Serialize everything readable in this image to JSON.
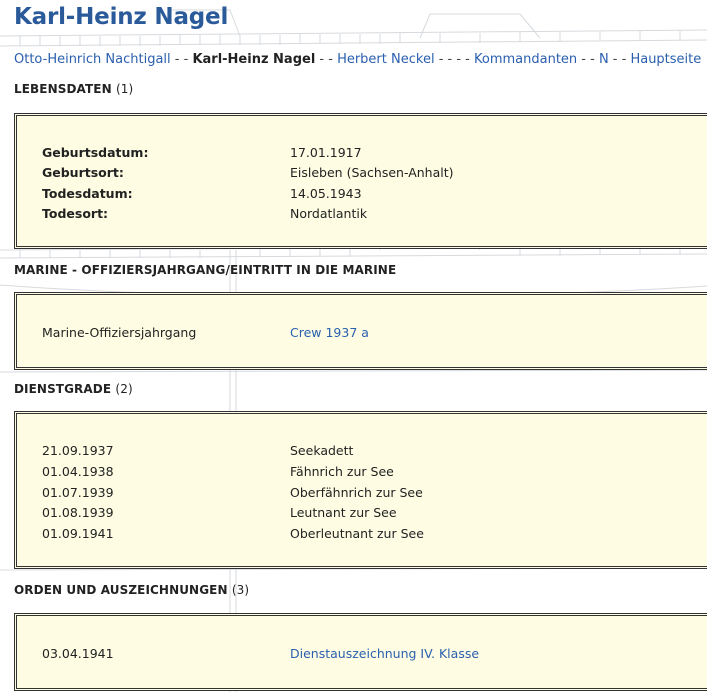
{
  "page": {
    "title": "Karl-Heinz Nagel"
  },
  "breadcrumb": {
    "prev": "Otto-Heinrich Nachtigall",
    "sep1": " - - ",
    "current": "Karl-Heinz Nagel",
    "sep2": " - - ",
    "next": "Herbert Neckel",
    "sep3": " - - - - ",
    "commanders": "Kommandanten",
    "sep4": " - - ",
    "letter": "N",
    "sep5": " - - ",
    "home": "Hauptseite"
  },
  "lebensdaten": {
    "heading": "LEBENSDATEN",
    "count": "(1)",
    "rows": [
      {
        "label": "Geburtsdatum:",
        "value": "17.01.1917"
      },
      {
        "label": "Geburtsort:",
        "value": "Eisleben (Sachsen-Anhalt)"
      },
      {
        "label": "Todesdatum:",
        "value": "14.05.1943"
      },
      {
        "label": "Todesort:",
        "value": "Nordatlantik"
      }
    ]
  },
  "marine": {
    "heading": "MARINE - OFFIZIERSJAHRGANG/EINTRITT IN DIE MARINE",
    "rows": [
      {
        "label": "Marine-Offiziersjahrgang",
        "value": "Crew 1937 a"
      }
    ]
  },
  "dienstgrade": {
    "heading": "DIENSTGRADE",
    "count": "(2)",
    "rows": [
      {
        "date": "21.09.1937",
        "rank": "Seekadett"
      },
      {
        "date": "01.04.1938",
        "rank": "Fähnrich zur See"
      },
      {
        "date": "01.07.1939",
        "rank": "Oberfähnrich zur See"
      },
      {
        "date": "01.08.1939",
        "rank": "Leutnant zur See"
      },
      {
        "date": "01.09.1941",
        "rank": "Oberleutnant zur See"
      }
    ]
  },
  "orden": {
    "heading": "ORDEN UND AUSZEICHNUNGEN",
    "count": "(3)",
    "rows": [
      {
        "date": "03.04.1941",
        "award": "Dienstauszeichnung IV. Klasse"
      }
    ]
  }
}
